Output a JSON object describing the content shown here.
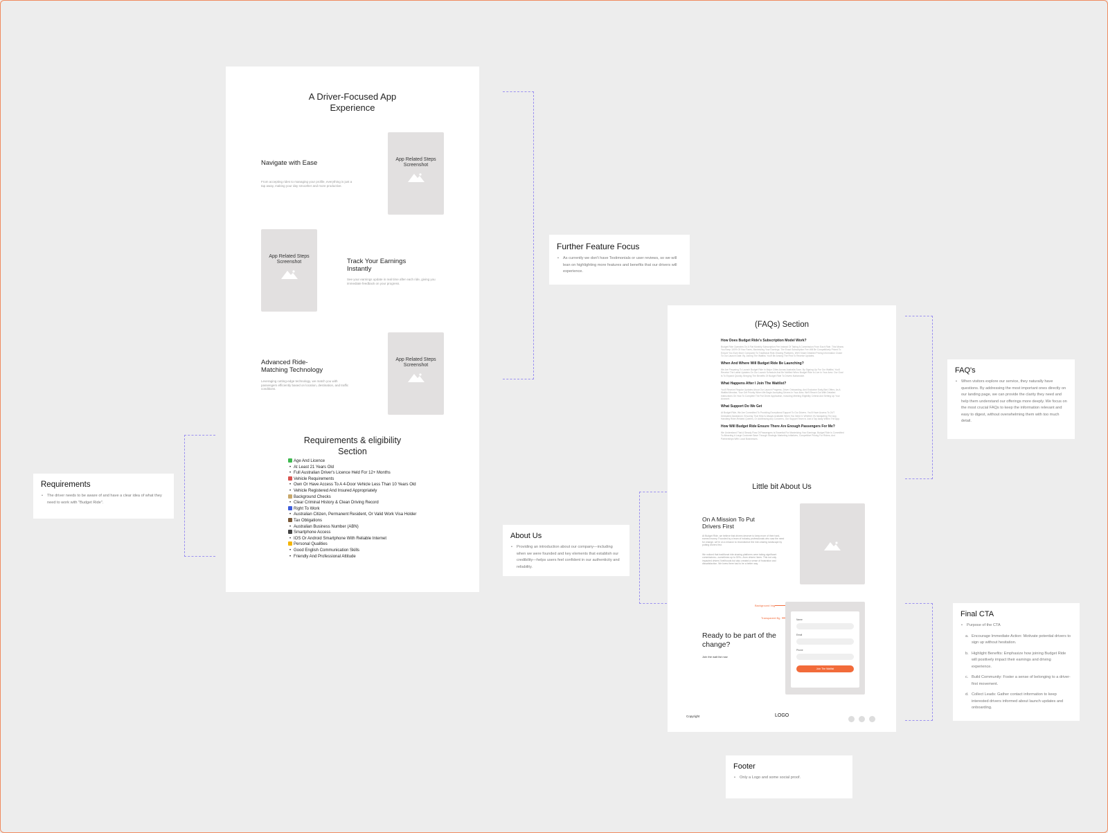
{
  "left_page": {
    "app_title": "A Driver-Focused App Experience",
    "screenshot_label_line1": "App Related Steps",
    "screenshot_label_line2": "Screenshot",
    "features": [
      {
        "title": "Navigate with Ease",
        "desc": "From accepting rides to managing your profile, everything is just a tap away, making your day smoother and more productive."
      },
      {
        "title": "Track Your Earnings Instantly",
        "desc": "See your earnings update in real time after each ride, giving you immediate feedback on your progress."
      },
      {
        "title": "Advanced Ride-Matching Technology",
        "desc": "Leveraging cutting-edge technology, we match you with passengers efficiently based on location, destination, and traffic conditions."
      }
    ],
    "requirements_title": "Requirements & eligibility Section",
    "requirements": [
      {
        "category": "Age And Licence",
        "color": "#3fb950",
        "items": [
          "At Least 21 Years Old",
          "Full Australian Driver's Licence Held For 12+ Months"
        ]
      },
      {
        "category": "Vehicle Requirements",
        "color": "#d9534f",
        "items": [
          "Own Or Have Access To A 4-Door Vehicle Less Than 10 Years Old",
          "Vehicle Registered And Insured Appropriately"
        ]
      },
      {
        "category": "Background Checks",
        "color": "#c9a86b",
        "items": [
          "Clear Criminal History & Clean Driving Record"
        ]
      },
      {
        "category": "Right To Work",
        "color": "#3b5bdb",
        "items": [
          "Australian Citizen, Permanent Resident, Or Valid Work Visa Holder"
        ]
      },
      {
        "category": "Tax Obligations",
        "color": "#7a5a3a",
        "items": [
          "Australian Business Number (ABN)"
        ]
      },
      {
        "category": "Smartphone Access",
        "color": "#444444",
        "items": [
          "IOS Or Android Smartphone With Reliable Internet"
        ]
      },
      {
        "category": "Personal Qualities",
        "color": "#f4b400",
        "items": [
          "Good English Communication Skills",
          "Friendly And Professional Attitude"
        ]
      }
    ]
  },
  "right_page": {
    "faq_title": "(FAQs) Section",
    "faqs": [
      {
        "q": "How Does Budget Ride's Subscription Model Work?",
        "a": "Budget Ride Operates On A Flat Monthly Subscription Fee Instead Of Taking A Commission From Each Ride. This Means You Keep 100% Of Your Fares, Maximizing Your Earnings. The Exact Subscription Fee Will Be Competitively Priced To Ensure You Earn More Compared To Traditional Ride-Sharing Platforms. We'll Share Detailed Pricing Information Closer To Our Launch Date. By Joining The Waitlist, You'll Be Among The First To Receive Updates."
      },
      {
        "q": "When And Where Will Budget Ride Be Launching?",
        "a": "We Are Preparing To Launch Budget Ride In Major Cities Across Australia Soon. By Signing Up For Our Waitlist, You'll Receive The Latest Updates On Our Launch Schedule And Be Notified When Budget Ride Is Live In Your Area. Our Goal Is To Expand Quickly, Bringing The Benefits Of Budget Ride To Drivers Nationwide."
      },
      {
        "q": "What Happens After I Join The Waitlist?",
        "a": "You'll Receive Regular Updates About Our Launch Progress, Driver Onboarding, And Exclusive Early-Bird Offers. As A Waitlist Member, Your Get Priority When We Begin Accepting Drivers In Your Area. We'll Reach Out With Detailed Instructions On How To Complete The Full Driver Application, Including Meeting Eligibility Criteria And Setting Up Your Account."
      },
      {
        "q": "What Support Do We Get",
        "a": "At Budget Ride, We Are Committed To Providing Exceptional Support To Our Drivers. You'll Have Access To 24/7 Dedicated Assistance, Ensuring That Help Is Always Available When You Need It. Whether It's Navigating The App, Handling Rider-Related Queries, Or Addressing Any Concerns, Our Support Team Is Just A Tap Away Within The App."
      },
      {
        "q": "How Will Budget Ride Ensure There Are Enough Passengers For Me?",
        "a": "We Understand That A Steady Flow Of Passengers Is Essential For Maximizing Your Earnings. Budget Ride Is Committed To Attracting A Large Customer Base Through Strategic Marketing Initiatives, Competitive Pricing For Riders, And Partnerships With Local Businesses."
      }
    ],
    "about_title": "Little bit About Us",
    "mission_title": "On A Mission To Put Drivers First",
    "mission_p1": "At Budget Ride, we believe that drivers deserve to keep more of their hard-earned money. Founded by a team of industry professionals who saw the need for change, we're on a mission to revolutionize the ride-sharing landscape by putting drivers first.",
    "mission_p2": "We noticed that traditional ride-sharing platforms were taking significant commissions—sometimes up to 30%—from drivers' fares. This not only impacted drivers' livelihoods but also created a sense of frustration and dissatisfaction. We knew there had to be a better way.",
    "cta_title": "Ready to be part of the change?",
    "cta_sub": "Join the wait list now",
    "bg_img_label": "Background Img",
    "transparent_bg_label": "Transparent Bg",
    "form_labels": [
      "Name",
      "Email",
      "Phone"
    ],
    "cta_button": "Join The Waitlist",
    "footer_copyright": "Copyright",
    "footer_logo": "LOGO"
  },
  "notes": {
    "further_feature": {
      "title": "Further Feature Focus",
      "body": "As currently we don't have Testimonials or user reviews, so we will lean on highlighting more features and benefits that our drivers will experience."
    },
    "requirements": {
      "title": "Requirements",
      "body": "The driver needs to be aware of and have a clear idea of what they need to work with \"Budget Ride\"."
    },
    "faqs": {
      "title": "FAQ's",
      "body": "When visitors explore our service, they naturally have questions. By addressing the most important ones directly on our landing page, we can provide the clarity they need and help them understand our offerings more deeply. We focus on the most crucial FAQs to keep the information relevant and easy to digest, without overwhelming them with too much detail."
    },
    "about": {
      "title": "About Us",
      "body": "Providing an introduction about our company—including when we were founded and key elements that establish our credibility—helps users feel confident in our authenticity and reliability."
    },
    "final_cta": {
      "title": "Final CTA",
      "intro": "Purpose of the CTA",
      "points": [
        {
          "letter": "a.",
          "text": "Encourage Immediate Action: Motivate potential drivers to sign up without hesitation."
        },
        {
          "letter": "b.",
          "text": "Highlight Benefits: Emphasize how joining Budget Ride will positively impact their earnings and driving experience."
        },
        {
          "letter": "c.",
          "text": "Build Community: Foster a sense of belonging to a driver-first movement."
        },
        {
          "letter": "d.",
          "text": "Collect Leads: Gather contact information to keep interested drivers informed about launch updates and onboarding."
        }
      ]
    },
    "footer": {
      "title": "Footer",
      "body": "Only a Logo and some social proof."
    }
  },
  "colors": {
    "accent": "#f26b3a",
    "connector": "#9a8ff0",
    "placeholder": "#e2e0e0",
    "canvas": "#ededed"
  }
}
